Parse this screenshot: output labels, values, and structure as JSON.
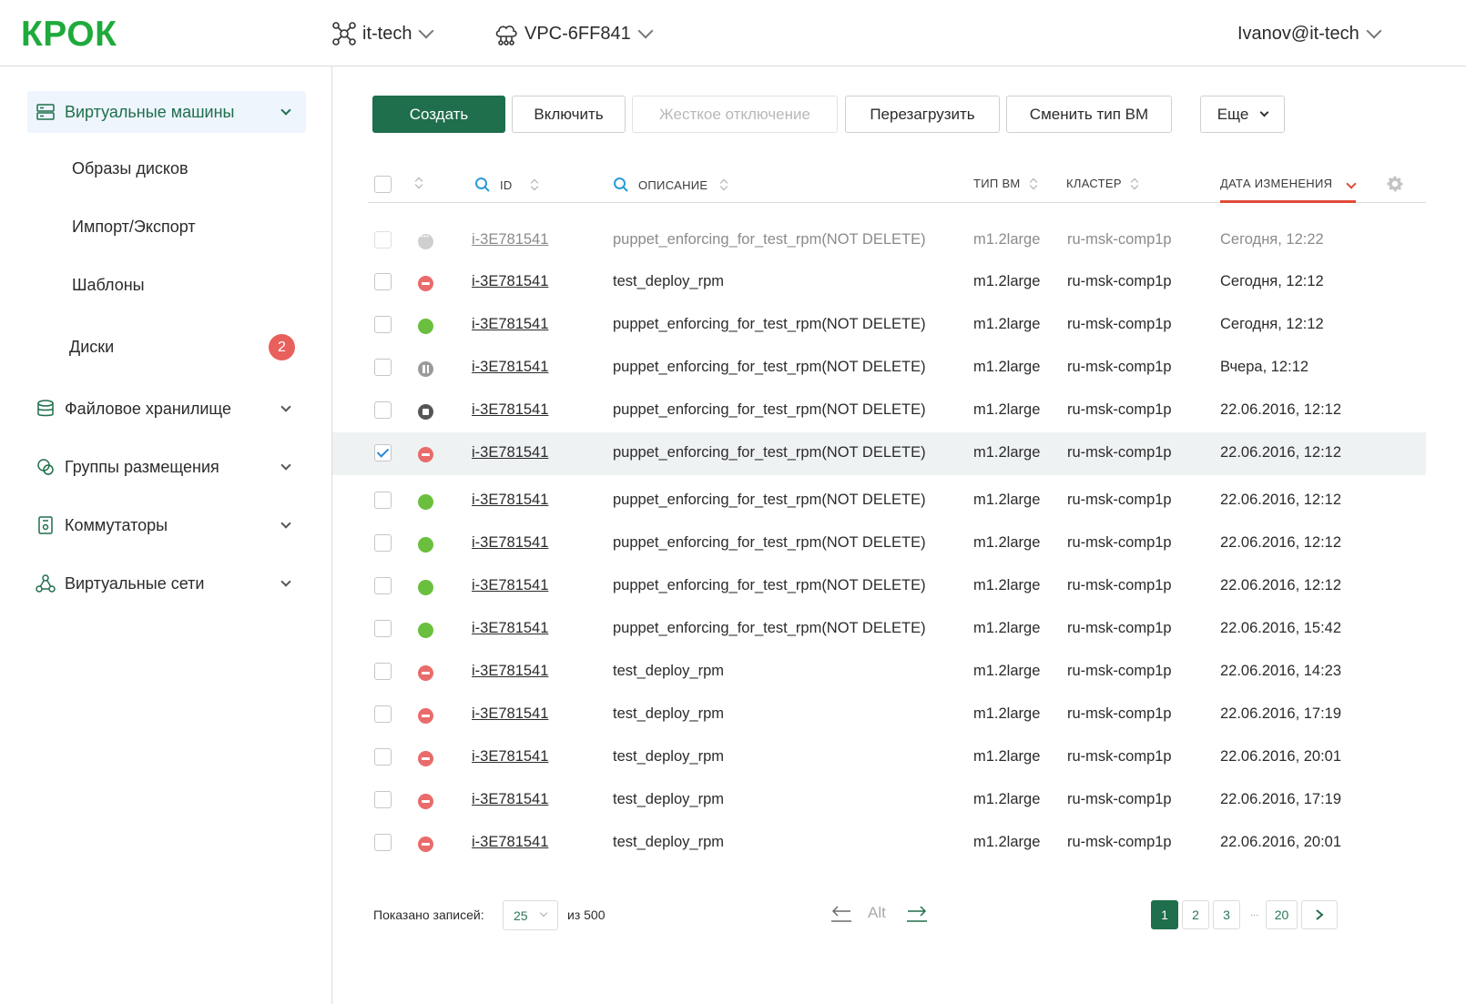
{
  "header": {
    "logo": "КРОК",
    "org": "it-tech",
    "vpc": "VPC-6FF841",
    "user": "Ivanov@it-tech"
  },
  "sidebar": {
    "vm_section": "Виртуальные машины",
    "sub_items": [
      "Образы дисков",
      "Импорт/Экспорт",
      "Шаблоны",
      "Диски"
    ],
    "disks_badge": "2",
    "sections": [
      "Файловое хранилище",
      "Группы размещения",
      "Коммутаторы",
      "Виртуальные сети"
    ]
  },
  "toolbar": {
    "create": "Создать",
    "power_on": "Включить",
    "hard_off": "Жесткое отключение",
    "reboot": "Перезагрузить",
    "change_type": "Сменить тип ВМ",
    "more": "Еще"
  },
  "table": {
    "columns": {
      "id": "ID",
      "description": "Описание",
      "vm_type": "Тип ВМ",
      "cluster": "Кластер",
      "modified": "Дата изменения"
    },
    "rows": [
      {
        "status": "pending",
        "id": "i-3E781541",
        "description": "puppet_enforcing_for_test_rpm(NOT DELETE)",
        "vm_type": "m1.2large",
        "cluster": "ru-msk-comp1p",
        "modified": "Сегодня, 12:22",
        "checked": false,
        "dim": true
      },
      {
        "status": "stop",
        "id": "i-3E781541",
        "description": "test_deploy_rpm",
        "vm_type": "m1.2large",
        "cluster": "ru-msk-comp1p",
        "modified": "Сегодня, 12:12",
        "checked": false
      },
      {
        "status": "green",
        "id": "i-3E781541",
        "description": "puppet_enforcing_for_test_rpm(NOT DELETE)",
        "vm_type": "m1.2large",
        "cluster": "ru-msk-comp1p",
        "modified": "Сегодня, 12:12",
        "checked": false
      },
      {
        "status": "pause",
        "id": "i-3E781541",
        "description": "puppet_enforcing_for_test_rpm(NOT DELETE)",
        "vm_type": "m1.2large",
        "cluster": "ru-msk-comp1p",
        "modified": "Вчера, 12:12",
        "checked": false
      },
      {
        "status": "stopped",
        "id": "i-3E781541",
        "description": "puppet_enforcing_for_test_rpm(NOT DELETE)",
        "vm_type": "m1.2large",
        "cluster": "ru-msk-comp1p",
        "modified": "22.06.2016, 12:12",
        "checked": false
      },
      {
        "status": "stop",
        "id": "i-3E781541",
        "description": "puppet_enforcing_for_test_rpm(NOT DELETE)",
        "vm_type": "m1.2large",
        "cluster": "ru-msk-comp1p",
        "modified": "22.06.2016, 12:12",
        "checked": true,
        "selected": true
      },
      {
        "status": "green",
        "id": "i-3E781541",
        "description": "puppet_enforcing_for_test_rpm(NOT DELETE)",
        "vm_type": "m1.2large",
        "cluster": "ru-msk-comp1p",
        "modified": "22.06.2016, 12:12",
        "checked": false
      },
      {
        "status": "green",
        "id": "i-3E781541",
        "description": "puppet_enforcing_for_test_rpm(NOT DELETE)",
        "vm_type": "m1.2large",
        "cluster": "ru-msk-comp1p",
        "modified": "22.06.2016, 12:12",
        "checked": false
      },
      {
        "status": "green",
        "id": "i-3E781541",
        "description": "puppet_enforcing_for_test_rpm(NOT DELETE)",
        "vm_type": "m1.2large",
        "cluster": "ru-msk-comp1p",
        "modified": "22.06.2016, 12:12",
        "checked": false
      },
      {
        "status": "green",
        "id": "i-3E781541",
        "description": "puppet_enforcing_for_test_rpm(NOT DELETE)",
        "vm_type": "m1.2large",
        "cluster": "ru-msk-comp1p",
        "modified": "22.06.2016, 15:42",
        "checked": false
      },
      {
        "status": "stop",
        "id": "i-3E781541",
        "description": "test_deploy_rpm",
        "vm_type": "m1.2large",
        "cluster": "ru-msk-comp1p",
        "modified": "22.06.2016, 14:23",
        "checked": false
      },
      {
        "status": "stop",
        "id": "i-3E781541",
        "description": "test_deploy_rpm",
        "vm_type": "m1.2large",
        "cluster": "ru-msk-comp1p",
        "modified": "22.06.2016, 17:19",
        "checked": false
      },
      {
        "status": "stop",
        "id": "i-3E781541",
        "description": "test_deploy_rpm",
        "vm_type": "m1.2large",
        "cluster": "ru-msk-comp1p",
        "modified": "22.06.2016, 20:01",
        "checked": false
      },
      {
        "status": "stop",
        "id": "i-3E781541",
        "description": "test_deploy_rpm",
        "vm_type": "m1.2large",
        "cluster": "ru-msk-comp1p",
        "modified": "22.06.2016, 17:19",
        "checked": false
      },
      {
        "status": "stop",
        "id": "i-3E781541",
        "description": "test_deploy_rpm",
        "vm_type": "m1.2large",
        "cluster": "ru-msk-comp1p",
        "modified": "22.06.2016, 20:01",
        "checked": false
      }
    ]
  },
  "footer": {
    "shown_label": "Показано записей:",
    "per_page": "25",
    "total": "из 500",
    "alt_label": "Alt",
    "pages": [
      "1",
      "2",
      "3",
      "20"
    ],
    "ellipsis": "...",
    "current_page": "1"
  }
}
